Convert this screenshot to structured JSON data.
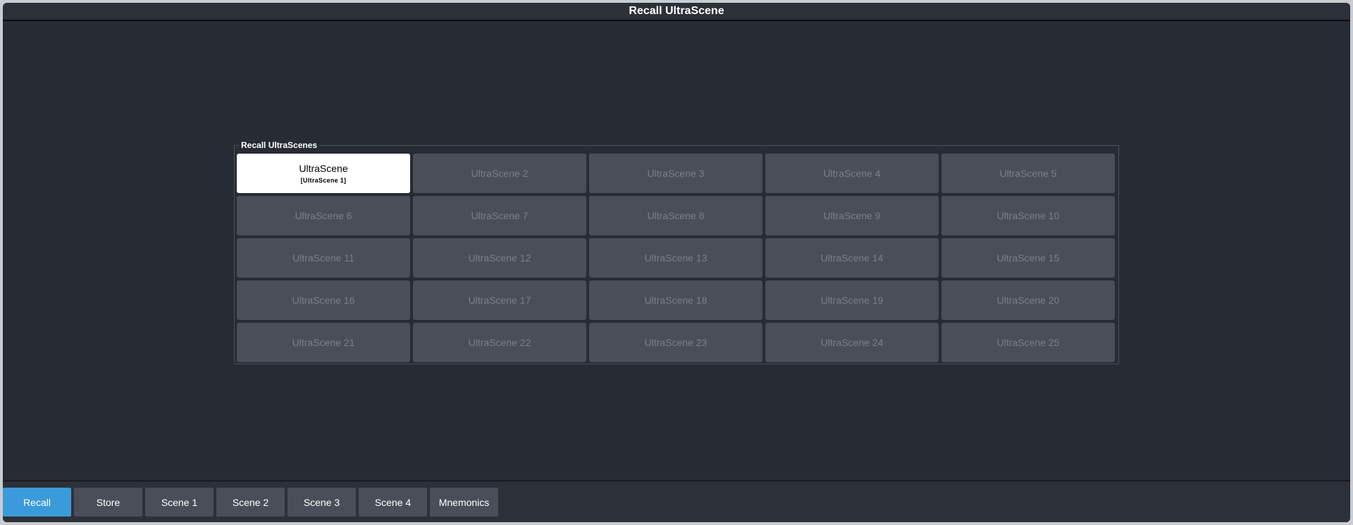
{
  "window": {
    "title": "Recall UltraScene"
  },
  "group": {
    "label": "Recall UltraScenes"
  },
  "scenes": [
    {
      "label": "UltraScene",
      "sub": "[UltraScene 1]",
      "active": true
    },
    {
      "label": "UltraScene 2"
    },
    {
      "label": "UltraScene 3"
    },
    {
      "label": "UltraScene 4"
    },
    {
      "label": "UltraScene 5"
    },
    {
      "label": "UltraScene 6"
    },
    {
      "label": "UltraScene 7"
    },
    {
      "label": "UltraScene 8"
    },
    {
      "label": "UltraScene 9"
    },
    {
      "label": "UltraScene 10"
    },
    {
      "label": "UltraScene 11"
    },
    {
      "label": "UltraScene 12"
    },
    {
      "label": "UltraScene 13"
    },
    {
      "label": "UltraScene 14"
    },
    {
      "label": "UltraScene 15"
    },
    {
      "label": "UltraScene 16"
    },
    {
      "label": "UltraScene 17"
    },
    {
      "label": "UltraScene 18"
    },
    {
      "label": "UltraScene 19"
    },
    {
      "label": "UltraScene 20"
    },
    {
      "label": "UltraScene 21"
    },
    {
      "label": "UltraScene 22"
    },
    {
      "label": "UltraScene 23"
    },
    {
      "label": "UltraScene 24"
    },
    {
      "label": "UltraScene 25"
    }
  ],
  "tabs": [
    {
      "label": "Recall",
      "active": true
    },
    {
      "label": "Store"
    },
    {
      "label": "Scene 1"
    },
    {
      "label": "Scene 2"
    },
    {
      "label": "Scene 3"
    },
    {
      "label": "Scene 4"
    },
    {
      "label": "Mnemonics"
    }
  ],
  "colors": {
    "accent": "#3b9ad9",
    "button": "#4a4e58",
    "background": "#272b33"
  }
}
